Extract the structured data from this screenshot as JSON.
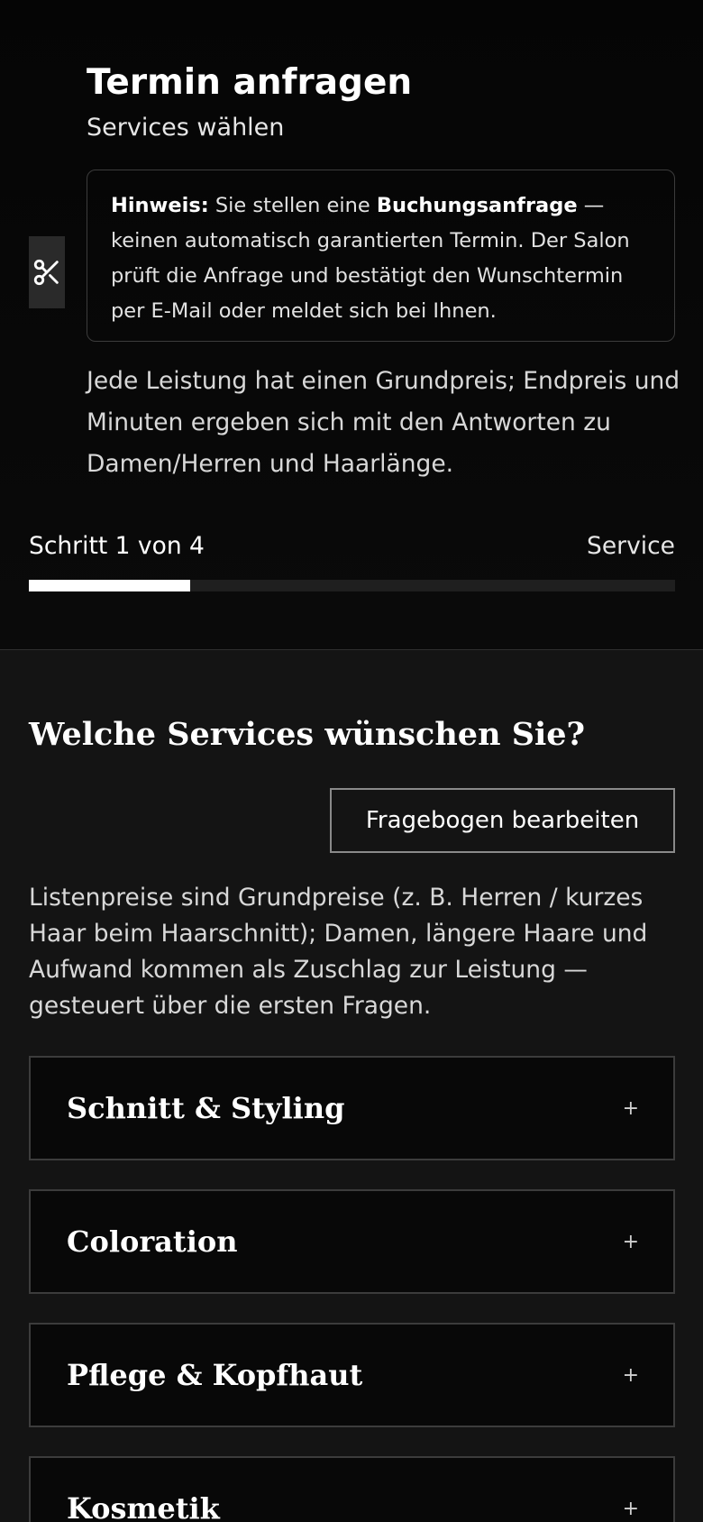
{
  "header": {
    "title": "Termin anfragen",
    "subtitle": "Services wählen",
    "notice": {
      "label": "Hinweis:",
      "text_before": " Sie stellen eine ",
      "emphasis": "Buchungsanfrage",
      "text_after": " — keinen automatisch garantierten Termin. Der Salon prüft die Anfrage und bestätigt den Wunschtermin per E-Mail oder meldet sich bei Ihnen."
    },
    "intro": "Jede Leistung hat einen Grundpreis; Endpreis und Minuten ergeben sich mit den Antworten zu Damen/Herren und Haarlänge.",
    "step": {
      "label": "Schritt 1 von 4",
      "name": "Service",
      "current": 1,
      "total": 4
    }
  },
  "main": {
    "section_title": "Welche Services wünschen Sie?",
    "edit_button": "Fragebogen bearbeiten",
    "description": "Listenpreise sind Grundpreise (z. B. Herren / kurzes Haar beim Haarschnitt); Damen, längere Haare und Aufwand kommen als Zuschlag zur Leistung — gesteuert über die ersten Fragen.",
    "categories": [
      {
        "label": "Schnitt & Styling",
        "toggle": "+"
      },
      {
        "label": "Coloration",
        "toggle": "+"
      },
      {
        "label": "Pflege & Kopfhaut",
        "toggle": "+"
      },
      {
        "label": "Kosmetik",
        "toggle": "+"
      }
    ]
  },
  "icons": {
    "side": "scissors-icon"
  },
  "colors": {
    "background": "#141414",
    "header_background": "#050505",
    "progress_fill": "#ffffff",
    "progress_track": "#1f1f1f",
    "border": "#3c3c3c"
  }
}
